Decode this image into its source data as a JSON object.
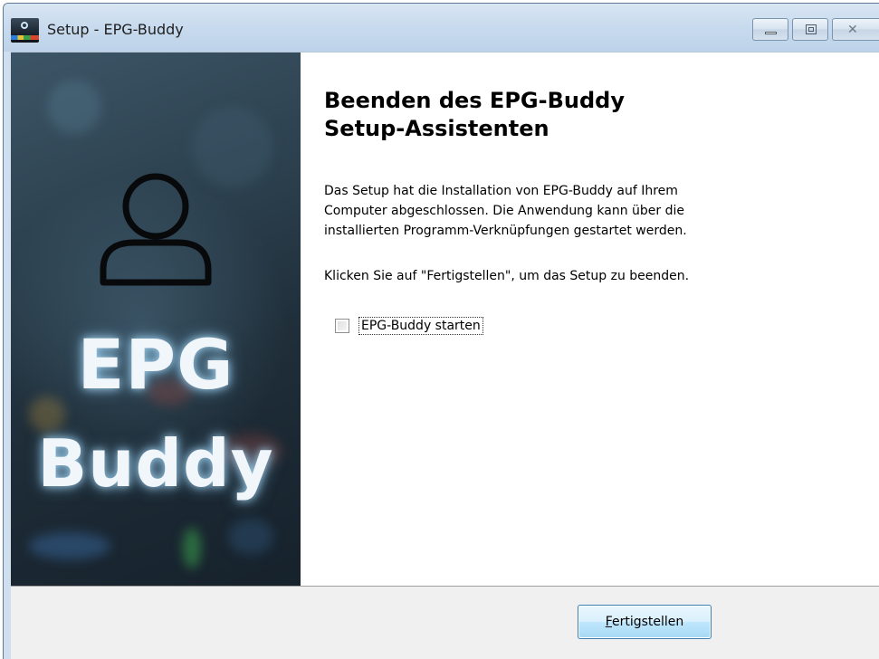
{
  "window": {
    "title": "Setup - EPG-Buddy",
    "icon": "epg-buddy-app-icon",
    "buttons": [
      "minimize-icon",
      "maximize-icon",
      "close-icon"
    ]
  },
  "banner": {
    "icon": "person-icon",
    "line1": "EPG",
    "line2": "Buddy"
  },
  "page": {
    "heading_line1": "Beenden des EPG-Buddy",
    "heading_line2": "Setup-Assistenten",
    "paragraph1_line1": "Das Setup hat die Installation von EPG-Buddy auf Ihrem",
    "paragraph1_line2": "Computer abgeschlossen. Die Anwendung kann über die",
    "paragraph1_line3": "installierten Programm-Verknüpfungen gestartet werden.",
    "paragraph2": "Klicken Sie auf \"Fertigstellen\", um das Setup zu beenden.",
    "launch_checkbox_label": "EPG-Buddy starten",
    "launch_checkbox_checked": false
  },
  "footer": {
    "finish_accel": "F",
    "finish_rest": "ertigstellen"
  },
  "colors": {
    "titlebar": "#c9dbee",
    "banner_dark": "#1f2e39",
    "button_border": "#3c7fb1",
    "footer_bg": "#f0f0f0"
  }
}
